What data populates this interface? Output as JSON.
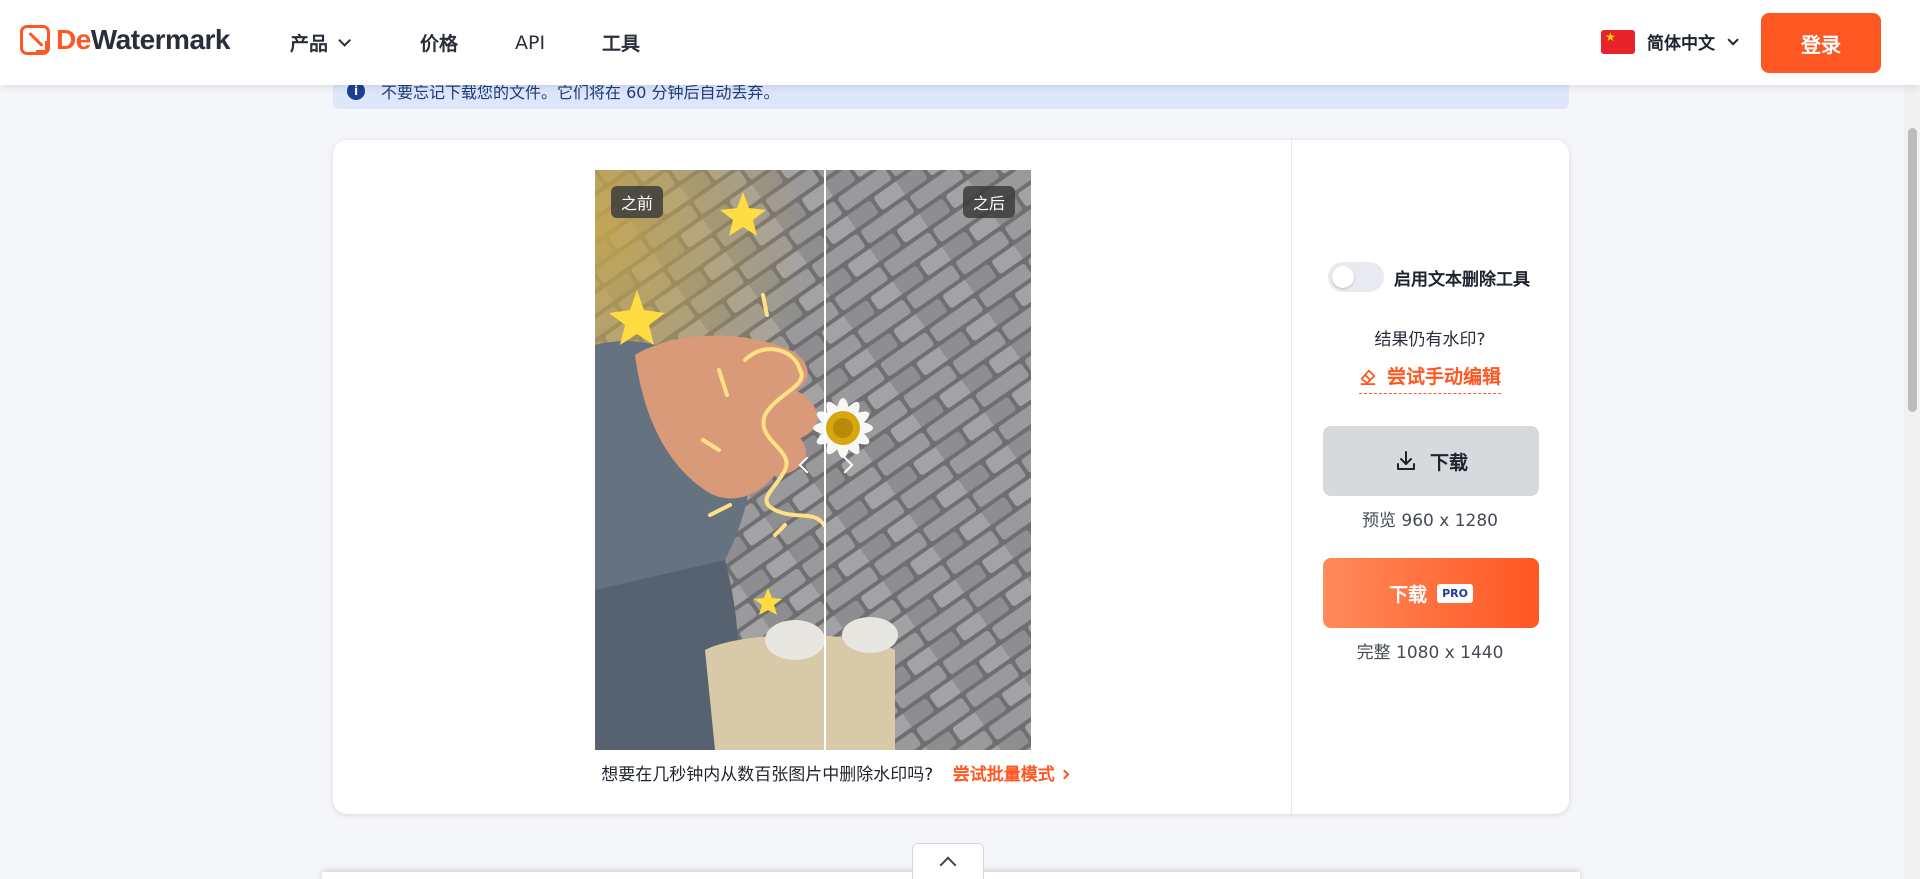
{
  "header": {
    "logo": {
      "part1": "De",
      "part2": "Watermark"
    },
    "nav": [
      {
        "label": "产品"
      },
      {
        "label": "价格"
      },
      {
        "label": "API"
      },
      {
        "label": "工具"
      }
    ],
    "language": "简体中文",
    "login_label": "登录"
  },
  "notice": {
    "icon": "info-icon",
    "text": "不要忘记下载您的文件。它们将在 60 分钟后自动丢弃。"
  },
  "editor": {
    "before_label": "之前",
    "after_label": "之后",
    "bulk_prompt": "想要在几秒钟内从数百张图片中删除水印吗?",
    "bulk_link": "尝试批量模式"
  },
  "side_panel": {
    "text_removal_toggle": {
      "label": "启用文本删除工具",
      "checked": false
    },
    "still_watermark_text": "结果仍有水印?",
    "manual_edit_label": "尝试手动编辑",
    "download_free": {
      "label": "下载",
      "size_text": "预览 960 x 1280"
    },
    "download_pro": {
      "label": "下载",
      "badge": "PRO",
      "size_text": "完整 1080 x 1440"
    }
  },
  "colors": {
    "brand": "#ff5722",
    "notice_bg": "#dde6fb",
    "pro_badge_text": "#1e3f95"
  },
  "icons": [
    "logo-icon",
    "chevron-down-icon",
    "china-flag-icon",
    "info-icon",
    "eraser-icon",
    "download-icon",
    "chevron-right-icon",
    "chevron-up-icon",
    "arrow-left-icon",
    "arrow-right-icon"
  ]
}
